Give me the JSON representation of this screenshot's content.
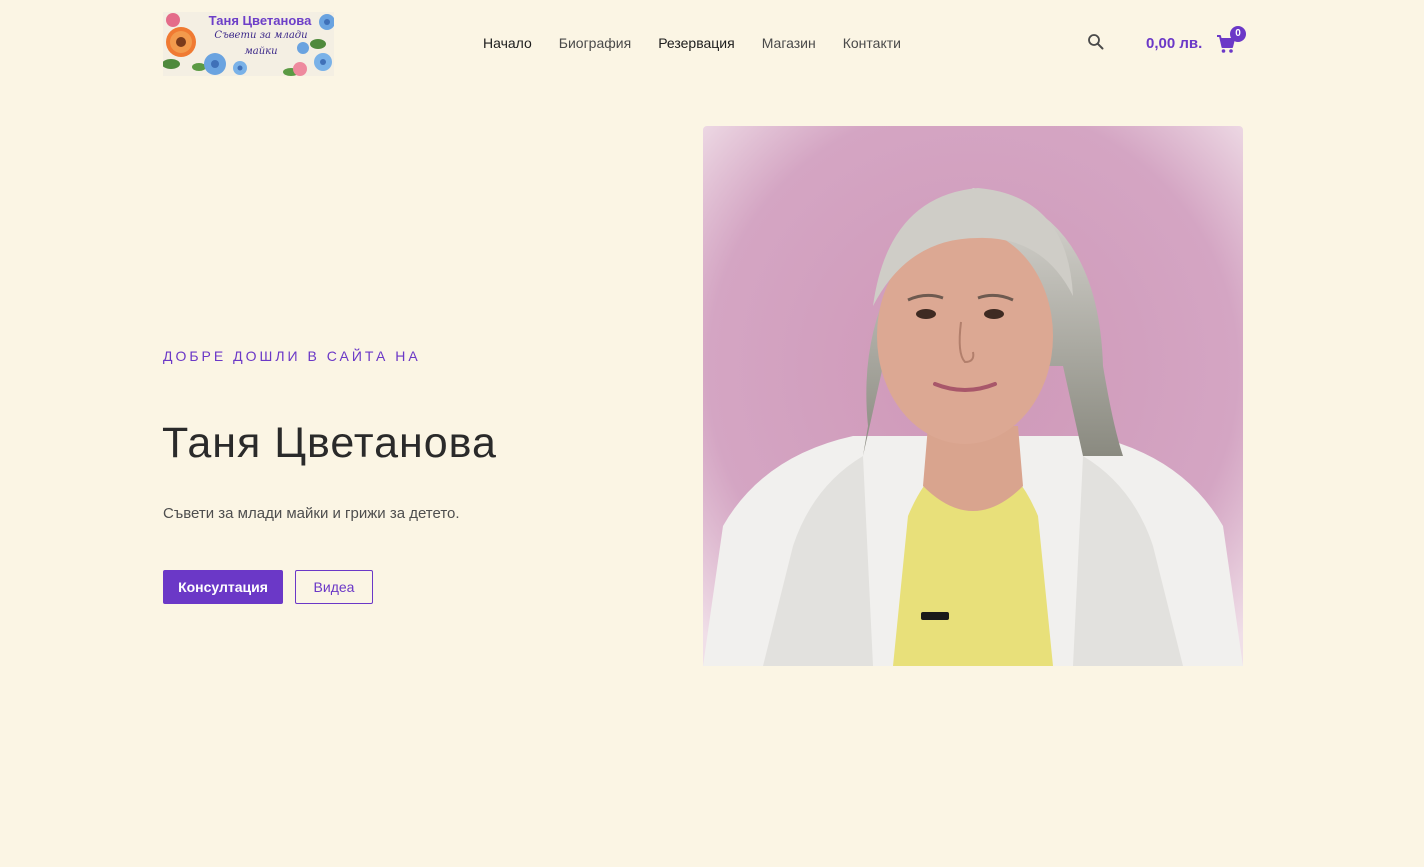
{
  "header": {
    "logo": {
      "title": "Таня Цветанова",
      "subtitle_line1": "Съвети за млади",
      "subtitle_line2": "майки"
    },
    "nav": [
      {
        "label": "Начало",
        "active": true
      },
      {
        "label": "Биография",
        "active": false
      },
      {
        "label": "Резервация",
        "active": true
      },
      {
        "label": "Магазин",
        "active": false
      },
      {
        "label": "Контакти",
        "active": false
      }
    ],
    "search_icon": "search-icon",
    "cart": {
      "total": "0,00 лв.",
      "count": "0",
      "icon": "cart-icon"
    }
  },
  "hero": {
    "kicker": "ДОБРЕ ДОШЛИ В САЙТА НА",
    "title": "Таня Цветанова",
    "subtitle": "Съвети за млади майки и грижи за детето.",
    "primary_button": "Консултация",
    "secondary_button": "Видеа"
  },
  "colors": {
    "background": "#fbf5e4",
    "accent": "#6b38c7",
    "portrait_background": "#d4a5c3"
  }
}
